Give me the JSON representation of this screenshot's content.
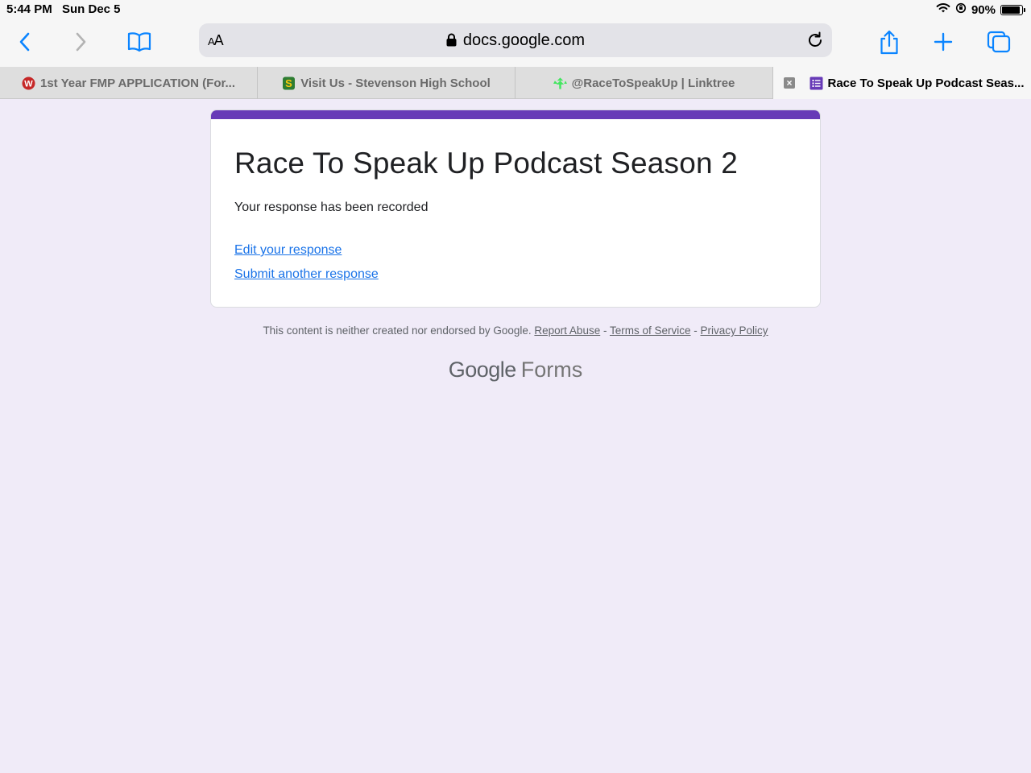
{
  "status": {
    "time": "5:44 PM",
    "date": "Sun Dec 5",
    "battery": "90%",
    "battery_level": 0.9
  },
  "toolbar": {
    "text_size_label_small": "A",
    "text_size_label_large": "A",
    "url": "docs.google.com",
    "accent_color": "#0a84ff"
  },
  "tabs": [
    {
      "label": "1st Year FMP APPLICATION (For...",
      "favicon": "w-logo-icon"
    },
    {
      "label": "Visit Us - Stevenson High School",
      "favicon": "s-logo-icon"
    },
    {
      "label": "@RaceToSpeakUp | Linktree",
      "favicon": "linktree-icon"
    },
    {
      "label": "Race To Speak Up Podcast Seas...",
      "favicon": "google-forms-icon",
      "active": true
    }
  ],
  "form": {
    "title": "Race To Speak Up Podcast Season 2",
    "message": "Your response has been recorded",
    "edit_link": "Edit your response",
    "another_link": "Submit another response",
    "theme_color": "#673ab7"
  },
  "footer": {
    "disclaimer": "This content is neither created nor endorsed by Google.",
    "report_abuse": "Report Abuse",
    "separator": " - ",
    "terms": "Terms of Service",
    "privacy": "Privacy Policy"
  },
  "brand": {
    "google": "Google",
    "forms": "Forms"
  }
}
